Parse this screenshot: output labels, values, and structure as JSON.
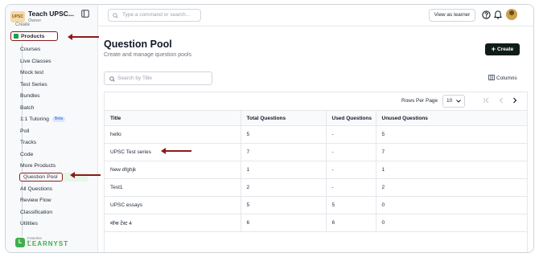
{
  "sidebar": {
    "brand_name": "Teach UPSC...",
    "brand_role": "Owner",
    "cut_label": "Create",
    "products_label": "Products",
    "items": [
      {
        "label": "Courses"
      },
      {
        "label": "Live Classes"
      },
      {
        "label": "Mock test"
      },
      {
        "label": "Test Series"
      },
      {
        "label": "Bundles"
      },
      {
        "label": "Batch"
      },
      {
        "label": "1:1 Tutoring",
        "badge": "Beta"
      },
      {
        "label": "Poll"
      },
      {
        "label": "Tracks"
      },
      {
        "label": "Code"
      },
      {
        "label": "More Products"
      },
      {
        "label": "Question Pool",
        "active": true
      },
      {
        "label": "All Questions"
      },
      {
        "label": "Review Flow"
      },
      {
        "label": "Classification"
      },
      {
        "label": "Utilities"
      }
    ],
    "footer_powered": "POWERED BY",
    "footer_logo": "LEARNYST"
  },
  "topbar": {
    "command_placeholder": "Type a command or search...",
    "view_as_learner": "View as learner",
    "icons": [
      "search-icon",
      "help-icon",
      "bell-icon",
      "avatar"
    ]
  },
  "page": {
    "title": "Question Pool",
    "subtitle": "Create and manage question pools",
    "create_label": "Create",
    "search_placeholder": "Search by Title",
    "columns_label": "Columns"
  },
  "pager": {
    "rows_per_page_label": "Rows Per Page",
    "rows_per_page_value": "10"
  },
  "table": {
    "headers": [
      "Title",
      "Total Questions",
      "Used Questions",
      "Unused Questions"
    ],
    "rows": [
      [
        "hello",
        "5",
        "-",
        "5"
      ],
      [
        "UPSC Test series",
        "7",
        "-",
        "7"
      ],
      [
        "New dfghjk",
        "1",
        "-",
        "1"
      ],
      [
        "Test1",
        "2",
        "-",
        "2"
      ],
      [
        "UPSC essays",
        "5",
        "5",
        "0"
      ],
      [
        "मॉक टेस्ट 4",
        "6",
        "6",
        "0"
      ]
    ]
  },
  "colors": {
    "accent": "#0f1d18",
    "annotation": "#8b1a1a",
    "brand_green": "#3db04b"
  }
}
